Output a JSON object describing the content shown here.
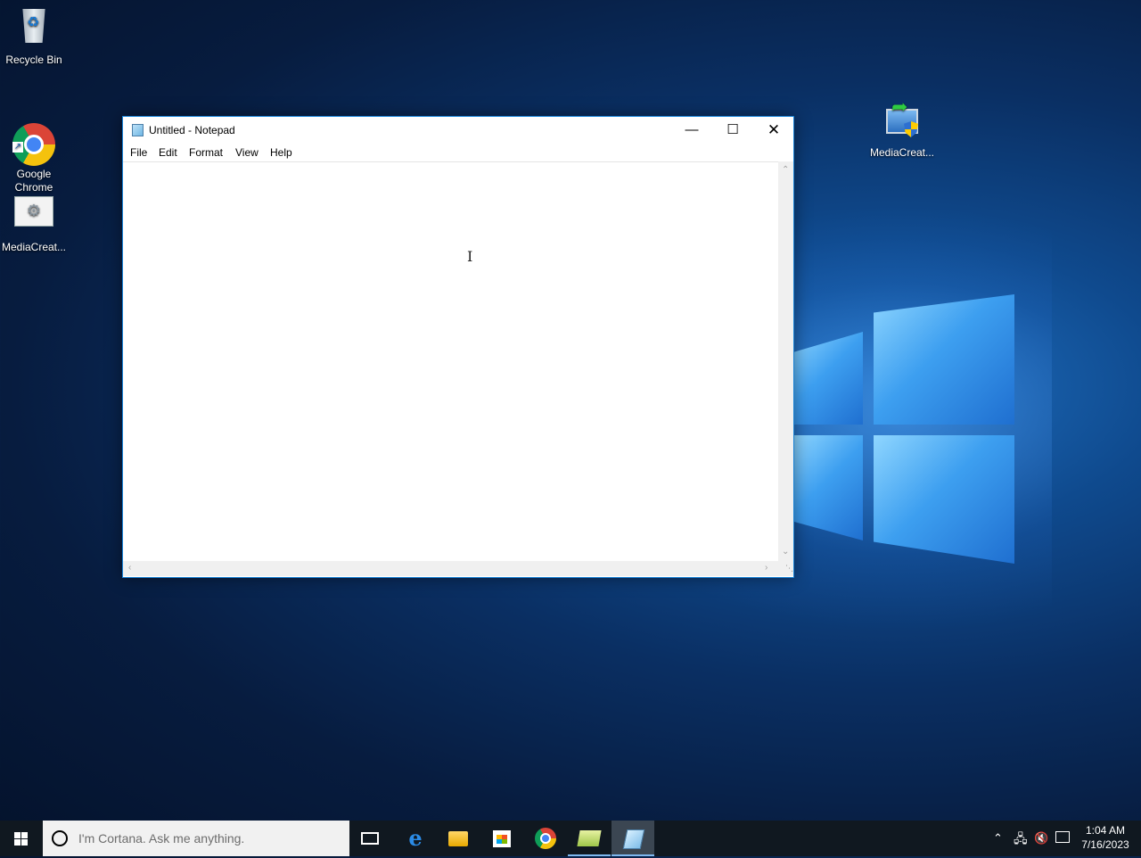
{
  "desktop": {
    "icons": [
      {
        "label": "Recycle Bin"
      },
      {
        "label": "Google\nChrome"
      },
      {
        "label": "MediaCreat..."
      },
      {
        "label": "MediaCreat..."
      }
    ]
  },
  "notepad": {
    "title": "Untitled - Notepad",
    "menu": [
      "File",
      "Edit",
      "Format",
      "View",
      "Help"
    ],
    "content": ""
  },
  "taskbar": {
    "search_placeholder": "I'm Cortana. Ask me anything.",
    "apps": [
      "task-view",
      "edge",
      "file-explorer",
      "store",
      "chrome",
      "explorer",
      "notepad"
    ],
    "active_app": "notepad"
  },
  "tray": {
    "time": "1:04 AM",
    "date": "7/16/2023",
    "icons": [
      "chevron-up-icon",
      "network-icon",
      "volume-muted-icon",
      "notification-icon"
    ]
  },
  "colors": {
    "accent": "#1883d7",
    "taskbar": "#101820"
  }
}
